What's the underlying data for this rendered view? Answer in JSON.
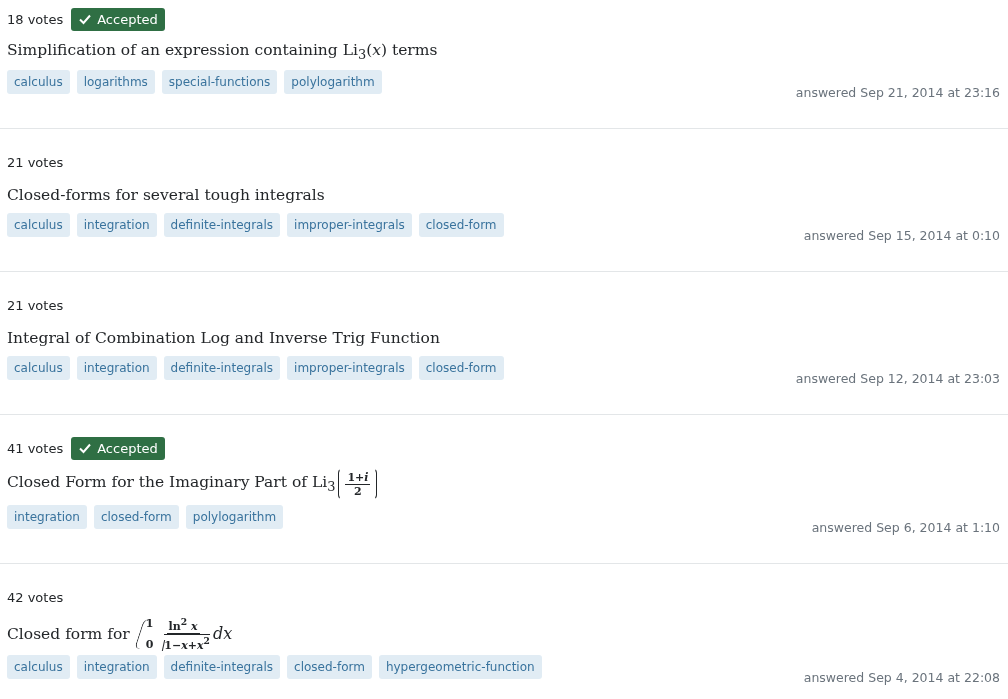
{
  "answers": [
    {
      "votes": "18 votes",
      "accepted": true,
      "accepted_label": "Accepted",
      "title": [
        {
          "kind": "text",
          "text": "Simplification of an expression containing Li$_{3}$(*x*) terms"
        }
      ],
      "tags": [
        "calculus",
        "logarithms",
        "special-functions",
        "polylogarithm"
      ],
      "answered": "answered Sep 21, 2014 at 23:16"
    },
    {
      "votes": "21 votes",
      "accepted": false,
      "title": [
        {
          "kind": "text",
          "text": "Closed-forms for several tough integrals"
        }
      ],
      "tags": [
        "calculus",
        "integration",
        "definite-integrals",
        "improper-integrals",
        "closed-form"
      ],
      "answered": "answered Sep 15, 2014 at 0:10"
    },
    {
      "votes": "21 votes",
      "accepted": false,
      "title": [
        {
          "kind": "text",
          "text": "Integral of Combination Log and Inverse Trig Function"
        }
      ],
      "tags": [
        "calculus",
        "integration",
        "definite-integrals",
        "improper-integrals",
        "closed-form"
      ],
      "answered": "answered Sep 12, 2014 at 23:03"
    },
    {
      "votes": "41 votes",
      "accepted": true,
      "accepted_label": "Accepted",
      "title": [
        {
          "kind": "text",
          "text": "Closed Form for the Imaginary Part of Li$_{3}$"
        },
        {
          "kind": "paren_frac",
          "num": "1+*i*",
          "den": "2"
        }
      ],
      "tags": [
        "integration",
        "closed-form",
        "polylogarithm"
      ],
      "answered": "answered Sep 6, 2014 at 1:10"
    },
    {
      "votes": "42 votes",
      "accepted": false,
      "title": [
        {
          "kind": "text",
          "text": "Closed form for "
        },
        {
          "kind": "integral",
          "lower": "0",
          "upper": "1",
          "num": "ln$^{2}$ *x*",
          "radicand": "1−*x*+*x*$^{2}$",
          "tail": "*dx*"
        }
      ],
      "tags": [
        "calculus",
        "integration",
        "definite-integrals",
        "closed-form",
        "hypergeometric-function"
      ],
      "answered": "answered Sep 4, 2014 at 22:08"
    }
  ]
}
